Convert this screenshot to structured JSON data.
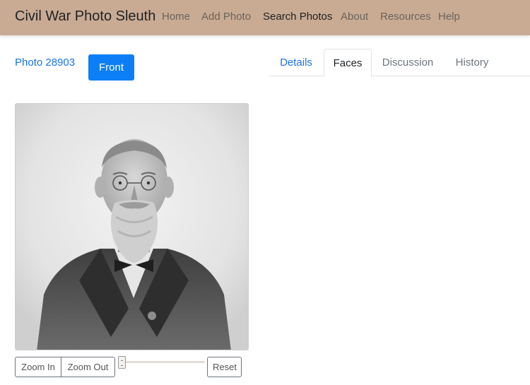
{
  "navbar": {
    "brand": "Civil War Photo Sleuth",
    "items": [
      {
        "label": "Home"
      },
      {
        "label": "Add Photo"
      },
      {
        "label": "Search Photos",
        "active": true
      },
      {
        "label": "About"
      },
      {
        "label": "Resources"
      },
      {
        "label": "Help"
      }
    ],
    "background": "#c9ab94"
  },
  "photo": {
    "link_label": "Photo 28903",
    "side_button": "Front",
    "image_icon": "portrait-photo"
  },
  "tabs": [
    {
      "label": "Details"
    },
    {
      "label": "Faces",
      "active": true
    },
    {
      "label": "Discussion"
    },
    {
      "label": "History"
    }
  ],
  "zoom": {
    "zoom_in_label": "Zoom In",
    "zoom_out_label": "Zoom Out",
    "reset_label": "Reset",
    "level": 0
  },
  "colors": {
    "primary": "#0d7ff6",
    "link": "#1a73e8"
  }
}
